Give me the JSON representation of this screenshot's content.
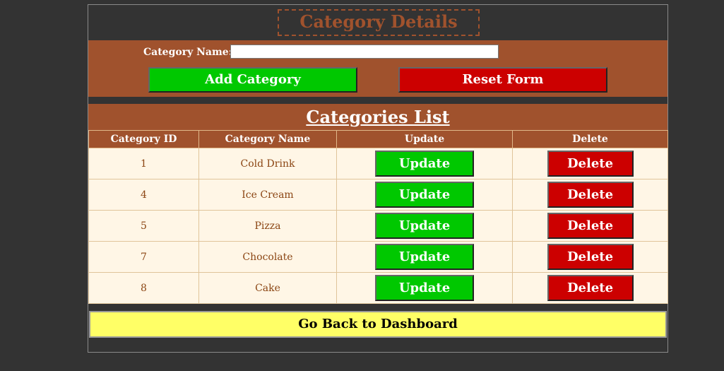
{
  "header": {
    "title": "Category Details"
  },
  "form": {
    "name_label": "Category Name:",
    "name_value": "",
    "add_label": "Add Category",
    "reset_label": "Reset Form"
  },
  "list": {
    "title": "Categories List",
    "columns": [
      "Category ID",
      "Category Name",
      "Update",
      "Delete"
    ],
    "rows": [
      {
        "id": "1",
        "name": "Cold Drink",
        "update": "Update",
        "delete": "Delete"
      },
      {
        "id": "4",
        "name": "Ice Cream",
        "update": "Update",
        "delete": "Delete"
      },
      {
        "id": "5",
        "name": "Pizza",
        "update": "Update",
        "delete": "Delete"
      },
      {
        "id": "7",
        "name": "Chocolate",
        "update": "Update",
        "delete": "Delete"
      },
      {
        "id": "8",
        "name": "Cake",
        "update": "Update",
        "delete": "Delete"
      }
    ]
  },
  "footer": {
    "back_label": "Go Back to Dashboard"
  },
  "colors": {
    "page_bg": "#333333",
    "brand_brown": "#a0522d",
    "update_green": "#00c800",
    "delete_red": "#cc0000",
    "cell_bg": "#fff6e6",
    "back_yellow": "#ffff66"
  }
}
